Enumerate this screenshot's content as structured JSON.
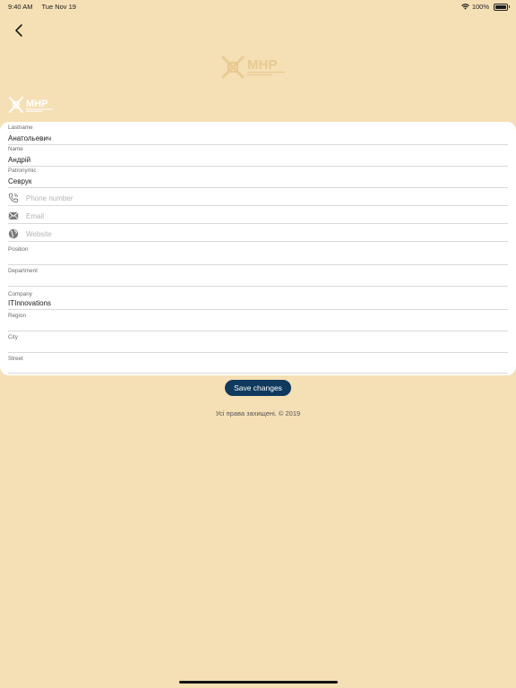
{
  "status": {
    "time": "9:40 AM",
    "date": "Tue Nov 19",
    "battery": "100%"
  },
  "logos": {
    "big_text": "MHP",
    "small_text": "MHP"
  },
  "form": {
    "lastname": {
      "label": "Lastname",
      "value": "Анатольевич"
    },
    "name": {
      "label": "Name",
      "value": "Андрій"
    },
    "patronymic": {
      "label": "Patronymic",
      "value": "Севрук"
    },
    "phone": {
      "placeholder": "Phone number"
    },
    "email": {
      "placeholder": "Email"
    },
    "website": {
      "placeholder": "Website"
    },
    "position": {
      "label": "Position",
      "value": ""
    },
    "department": {
      "label": "Department",
      "value": ""
    },
    "company": {
      "label": "Company",
      "value": "ITInnovations"
    },
    "region": {
      "label": "Region",
      "value": ""
    },
    "city": {
      "label": "City",
      "value": ""
    },
    "street": {
      "label": "Street",
      "value": ""
    }
  },
  "save_label": "Save changes",
  "footer": "Усі права захищені. © 2019",
  "icons": {
    "back": "chevron-left-icon",
    "phone": "phone-icon",
    "email": "envelope-icon",
    "website": "globe-icon"
  },
  "colors": {
    "background": "#f5dfb5",
    "button": "#0f3a5e",
    "card": "#ffffff"
  }
}
